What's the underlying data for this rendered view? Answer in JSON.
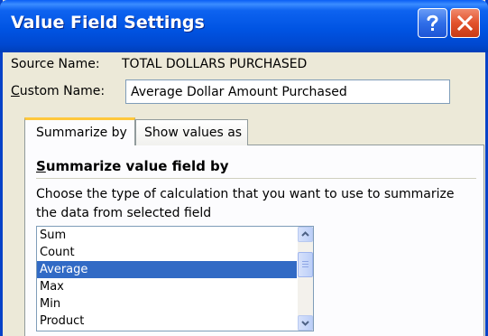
{
  "window": {
    "title": "Value Field Settings",
    "help_icon": "question-mark-icon",
    "close_icon": "close-x-icon"
  },
  "source": {
    "label": "Source Name:",
    "value": "TOTAL DOLLARS PURCHASED"
  },
  "custom_name": {
    "label": "Custom Name:",
    "value": "Average Dollar Amount Purchased"
  },
  "tabs": [
    {
      "label": "Summarize by",
      "active": true
    },
    {
      "label": "Show values as",
      "active": false
    }
  ],
  "summarize": {
    "heading": "Summarize value field by",
    "description": "Choose the type of calculation that you want to use to summarize the data from selected field",
    "items": [
      "Sum",
      "Count",
      "Average",
      "Max",
      "Min",
      "Product"
    ],
    "selected": "Average"
  },
  "colors": {
    "title_bar": "#0054e3",
    "selection": "#316ac5",
    "active_tab_highlight": "#ffc83c",
    "close_button": "#e2522c",
    "dialog_background": "#ece9d8"
  }
}
